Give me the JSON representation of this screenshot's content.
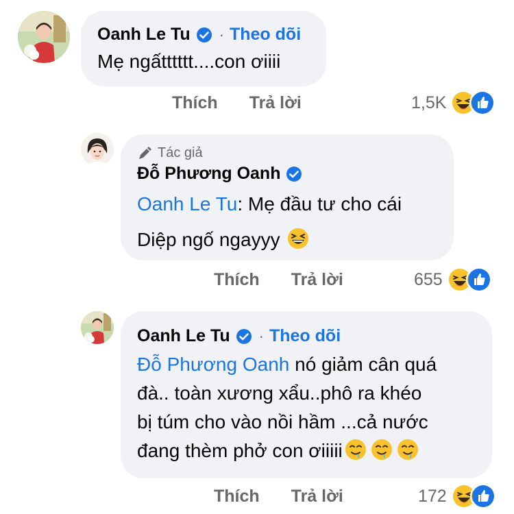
{
  "comments": [
    {
      "author": "Oanh Le Tu",
      "follow_label": "Theo dõi",
      "text": "Mẹ ngấtttttt....con ơiiii",
      "like_label": "Thích",
      "reply_label": "Trả lời",
      "reaction_count": "1,5K"
    },
    {
      "author_badge": "Tác giả",
      "author": "Đỗ Phương Oanh",
      "mention": "Oanh Le Tu",
      "text_line1": ": Mẹ đầu tư cho cái",
      "text_line2": "Diệp ngố ngayyy",
      "like_label": "Thích",
      "reply_label": "Trả lời",
      "reaction_count": "655"
    },
    {
      "author": "Oanh Le Tu",
      "follow_label": "Theo dõi",
      "mention": "Đỗ Phương Oanh",
      "text_line1": " nó giảm cân quá",
      "text_line2": "đà.. toàn xương xẩu..phô ra khéo",
      "text_line3": "bị túm cho vào nồi hầm ...cả nước",
      "text_line4": "đang thèm phở con ơiiiii",
      "like_label": "Thích",
      "reply_label": "Trả lời",
      "reaction_count": "172"
    }
  ],
  "colors": {
    "link_blue": "#1b74e4",
    "bubble_bg": "#f0f2f5",
    "muted_text": "#65676b"
  },
  "icons": [
    "verified-badge-icon",
    "pen-icon",
    "haha-reaction-icon",
    "like-reaction-icon",
    "drooling-face-emoji",
    "laughing-emoji"
  ]
}
